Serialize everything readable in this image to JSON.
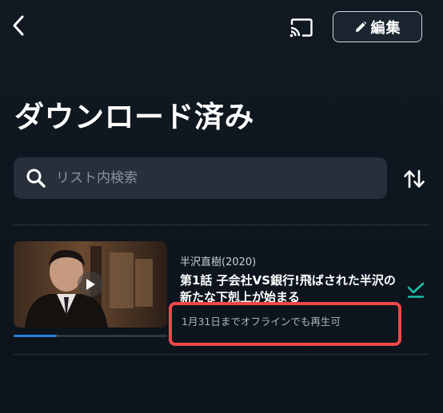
{
  "header": {
    "edit_label": "編集"
  },
  "page": {
    "title": "ダウンロード済み"
  },
  "search": {
    "placeholder": "リスト内検索",
    "value": ""
  },
  "downloads": [
    {
      "series": "半沢直樹(2020)",
      "title": "第1話 子会社VS銀行!飛ばされた半沢の新たな下剋上が始まる",
      "expiry": "1月31日までオフラインでも再生可",
      "progress_fraction": 0.28,
      "status": "downloaded"
    }
  ],
  "colors": {
    "background": "#0e161f",
    "search_bg": "#262f3a",
    "accent_teal": "#18c2a8",
    "progress_blue": "#2b7fe0",
    "highlight_red": "#f04848"
  },
  "icons": {
    "back": "chevron-left-icon",
    "cast": "cast-icon",
    "edit": "pencil-icon",
    "search": "search-icon",
    "sort": "sort-arrows-icon",
    "play": "play-icon",
    "downloaded": "download-check-icon"
  }
}
